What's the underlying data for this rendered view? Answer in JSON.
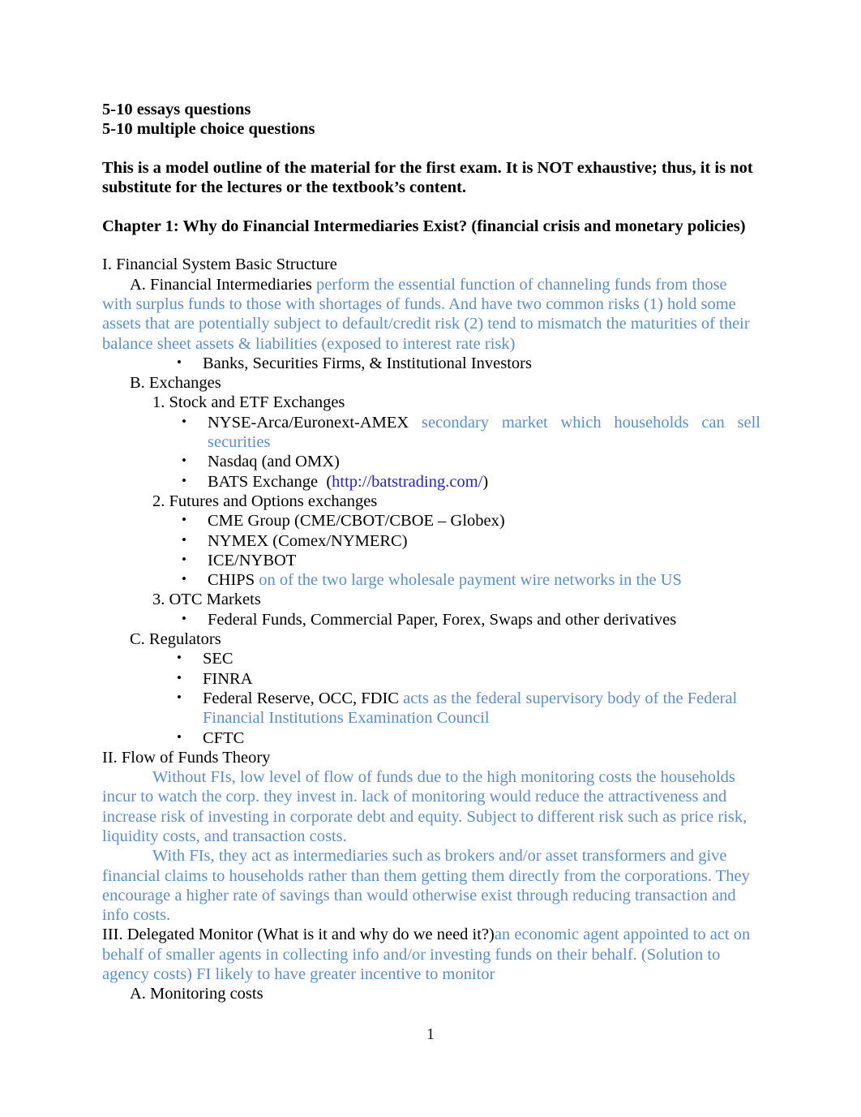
{
  "document": {
    "page_number": "1",
    "colors": {
      "annotation_blue": "#5b8ecb",
      "hyperlink_blue": "#2222cc",
      "body_black": "#000000"
    }
  },
  "header": {
    "line1": "5-10 essays questions",
    "line2": "5-10 multiple choice questions",
    "note": "This is a model outline of the material for the first exam. It is NOT exhaustive; thus, it is not substitute for the lectures or the textbook’s content.",
    "chapter_title": "Chapter 1: Why do Financial Intermediaries Exist? (financial crisis and monetary policies)"
  },
  "section_I": {
    "heading": "I. Financial System Basic Structure",
    "A": {
      "label": "A. Financial Intermediaries",
      "annotation": "perform the essential function of channeling funds from those with surplus funds to those with shortages of funds. And have two common risks (1) hold some assets that are potentially subject to default/credit risk (2) tend to mismatch the maturities of their balance sheet assets & liabilities (exposed to interest rate risk)",
      "bullets": [
        {
          "text": "Banks, Securities Firms, & Institutional Investors"
        }
      ]
    },
    "B": {
      "label": "B. Exchanges",
      "groups": [
        {
          "label": "1. Stock and ETF Exchanges",
          "bullets": [
            {
              "text": "NYSE-Arca/Euronext-AMEX",
              "annotation": "secondary market which households can sell securities"
            },
            {
              "text": "Nasdaq (and OMX)"
            },
            {
              "text": "BATS Exchange",
              "link_open": "(",
              "link": "http://batstrading.com/",
              "link_close": ")"
            }
          ]
        },
        {
          "label": "2. Futures and Options exchanges",
          "bullets": [
            {
              "text": "CME Group (CME/CBOT/CBOE – Globex)"
            },
            {
              "text": "NYMEX (Comex/NYMERC)"
            },
            {
              "text": "ICE/NYBOT"
            },
            {
              "text": "CHIPS",
              "annotation": "on of the two large wholesale payment wire networks in the US"
            }
          ]
        },
        {
          "label": "3. OTC Markets",
          "bullets": [
            {
              "text": "Federal Funds, Commercial Paper, Forex, Swaps and other derivatives"
            }
          ]
        }
      ]
    },
    "C": {
      "label": "C. Regulators",
      "bullets": [
        {
          "text": "SEC"
        },
        {
          "text": "FINRA"
        },
        {
          "text": "Federal Reserve, OCC, FDIC",
          "annotation": "acts as the federal supervisory body of the Federal Financial Institutions Examination Council"
        },
        {
          "text": "CFTC"
        }
      ]
    }
  },
  "section_II": {
    "heading": "II. Flow of Funds Theory",
    "paragraph1": "Without FIs, low level of flow of funds due to the high monitoring costs the households incur to watch the corp. they invest in. lack of monitoring would reduce the attractiveness and increase risk of investing in corporate debt and equity. Subject to different risk such as price risk, liquidity costs, and transaction costs.",
    "paragraph2": "With FIs, they act as intermediaries such as brokers and/or asset transformers and give financial claims to households rather than them getting them directly from the corporations. They encourage a higher rate of savings than would otherwise exist through reducing transaction and info costs."
  },
  "section_III": {
    "heading": "III. Delegated Monitor (What is it and why do we need it?)",
    "annotation": "an economic agent appointed to act on behalf of smaller agents in collecting info and/or investing funds on their behalf. (Solution to agency costs) FI likely to have greater incentive to monitor",
    "A": {
      "label": "A. Monitoring costs"
    }
  }
}
